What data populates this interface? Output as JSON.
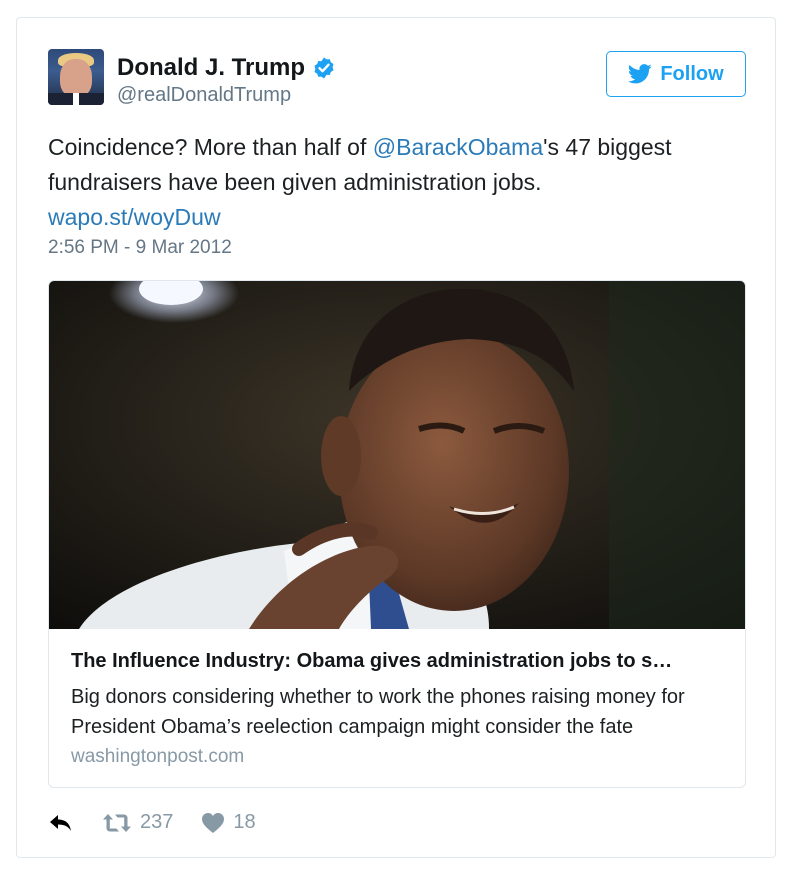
{
  "tweet": {
    "author": {
      "name": "Donald J. Trump",
      "handle": "@realDonaldTrump",
      "verified": true,
      "avatar": "profile-photo"
    },
    "follow_label": "Follow",
    "text_prefix": "Coincidence? More than half of ",
    "mention": "@BarackObama",
    "text_suffix": "'s 47 biggest fundraisers have been given administration jobs.",
    "link": "wapo.st/woyDuw",
    "timestamp": "2:56 PM - 9 Mar 2012",
    "card": {
      "image": "photo-of-barack-obama-speaking",
      "title": "The Influence Industry: Obama gives administration jobs to s…",
      "description": "Big donors considering whether to work the phones raising money for President Obama’s reelection campaign might consider the fate",
      "domain": "washingtonpost.com"
    },
    "actions": {
      "reply_icon": "reply-icon",
      "retweet_icon": "retweet-icon",
      "retweet_count": "237",
      "like_icon": "heart-icon",
      "like_count": "18"
    },
    "colors": {
      "link": "#2b7bb9",
      "follow": "#1da1f2",
      "muted": "#657786"
    }
  }
}
